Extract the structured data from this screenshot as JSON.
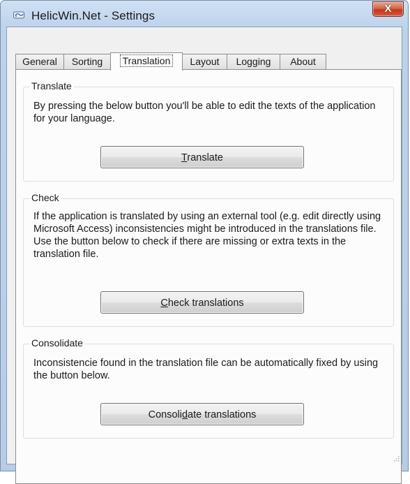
{
  "window": {
    "title": "HelicWin.Net - Settings",
    "close_label": "X"
  },
  "tabs": [
    {
      "label": "General",
      "active": false
    },
    {
      "label": "Sorting",
      "active": false
    },
    {
      "label": "Translation",
      "active": true
    },
    {
      "label": "Layout",
      "active": false
    },
    {
      "label": "Logging",
      "active": false
    },
    {
      "label": "About",
      "active": false
    }
  ],
  "translate_group": {
    "title": "Translate",
    "description": "By pressing the below button you'll be able to edit the texts of the application for your language.",
    "button": {
      "mnemonic": "T",
      "rest": "ranslate"
    }
  },
  "check_group": {
    "title": "Check",
    "description": "If the application is translated by using an external tool (e.g. edit directly using Microsoft Access) inconsistencies might be introduced in the translations file. Use the button below to check if there are missing or extra texts in the translation file.",
    "button": {
      "mnemonic": "C",
      "rest": "heck translations"
    }
  },
  "consolidate_group": {
    "title": "Consolidate",
    "description": "Inconsistencie found in the translation file can be automatically fixed by using the button below.",
    "button": {
      "before": "Consoli",
      "mnemonic": "d",
      "rest": "ate translations"
    }
  }
}
